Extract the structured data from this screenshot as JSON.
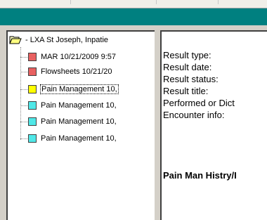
{
  "tree": {
    "root_label": "- LXA St Joseph, Inpatie",
    "items": [
      {
        "label": "MAR 10/21/2009 9:57",
        "color": "#e86060"
      },
      {
        "label": "Flowsheets 10/21/20",
        "color": "#e86060"
      },
      {
        "label": "Pain Management 10,",
        "color": "#ffff00"
      },
      {
        "label": "Pain Management 10,",
        "color": "#50e8e8"
      },
      {
        "label": "Pain Management 10,",
        "color": "#50e8e8"
      },
      {
        "label": "Pain Management 10,",
        "color": "#50e8e8"
      }
    ]
  },
  "detail": {
    "fields": [
      "Result type:",
      "Result date:",
      "Result status:",
      "Result title:",
      "Performed or Dict",
      "Encounter info:"
    ],
    "document_title": "Pain Man Histry/I"
  },
  "colors": {
    "header_bar": "#008080",
    "window_bg": "#d4d0c8"
  }
}
